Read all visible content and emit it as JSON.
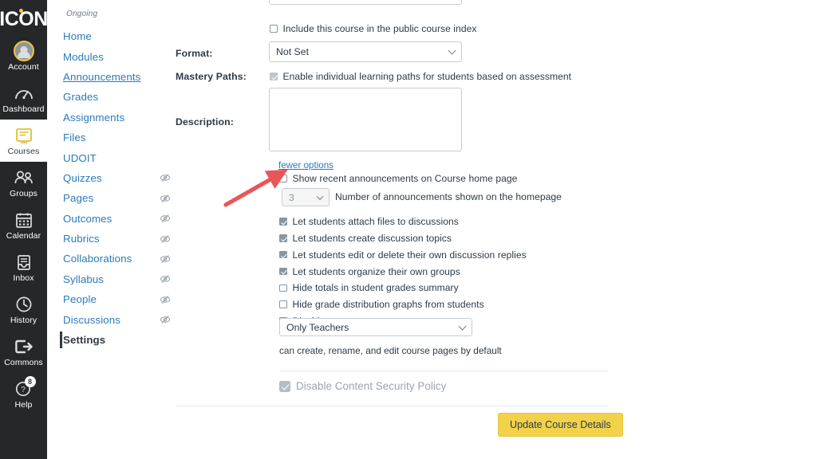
{
  "global_nav": {
    "logo": "ICON",
    "items": [
      {
        "label": "Account",
        "icon": "avatar-icon",
        "badge": null
      },
      {
        "label": "Dashboard",
        "icon": "dashboard-gauge-icon",
        "badge": null
      },
      {
        "label": "Courses",
        "icon": "courses-book-icon",
        "badge": null
      },
      {
        "label": "Groups",
        "icon": "groups-people-icon",
        "badge": null
      },
      {
        "label": "Calendar",
        "icon": "calendar-icon",
        "badge": null
      },
      {
        "label": "Inbox",
        "icon": "inbox-tray-icon",
        "badge": null
      },
      {
        "label": "History",
        "icon": "history-clock-icon",
        "badge": null
      },
      {
        "label": "Commons",
        "icon": "commons-arrow-icon",
        "badge": null
      },
      {
        "label": "Help",
        "icon": "help-question-icon",
        "badge": "8"
      }
    ],
    "active": "Courses"
  },
  "course_nav": {
    "term": "Ongoing",
    "items": [
      {
        "label": "Home",
        "hidden": false
      },
      {
        "label": "Modules",
        "hidden": false
      },
      {
        "label": "Announcements",
        "hidden": false
      },
      {
        "label": "Grades",
        "hidden": false
      },
      {
        "label": "Assignments",
        "hidden": false
      },
      {
        "label": "Files",
        "hidden": false
      },
      {
        "label": "UDOIT",
        "hidden": false
      },
      {
        "label": "Quizzes",
        "hidden": true
      },
      {
        "label": "Pages",
        "hidden": true
      },
      {
        "label": "Outcomes",
        "hidden": true
      },
      {
        "label": "Rubrics",
        "hidden": true
      },
      {
        "label": "Collaborations",
        "hidden": true
      },
      {
        "label": "Syllabus",
        "hidden": true
      },
      {
        "label": "People",
        "hidden": true
      },
      {
        "label": "Discussions",
        "hidden": true
      },
      {
        "label": "Settings",
        "hidden": false
      }
    ],
    "active": "Settings",
    "hidden_icon": "eye-slash-icon"
  },
  "form": {
    "public_index_checkbox": {
      "label": "Include this course in the public course index",
      "checked": false
    },
    "format": {
      "label": "Format:",
      "value": "Not Set"
    },
    "mastery_paths": {
      "label": "Mastery Paths:",
      "checkbox_label": "Enable individual learning paths for students based on assessment",
      "checked": true,
      "disabled": true
    },
    "description": {
      "label": "Description:",
      "value": ""
    },
    "fewer_options_link": "fewer options",
    "show_recent_announcements": {
      "label": "Show recent announcements on Course home page",
      "checked": false
    },
    "announcements_count": {
      "value": "3",
      "label": "Number of announcements shown on the homepage",
      "disabled": true
    },
    "option_checkboxes": [
      {
        "label": "Let students attach files to discussions",
        "checked": true
      },
      {
        "label": "Let students create discussion topics",
        "checked": true
      },
      {
        "label": "Let students edit or delete their own discussion replies",
        "checked": true
      },
      {
        "label": "Let students organize their own groups",
        "checked": true
      },
      {
        "label": "Hide totals in student grades summary",
        "checked": false
      },
      {
        "label": "Hide grade distribution graphs from students",
        "checked": false
      },
      {
        "label": "Disable comments on announcements",
        "checked": false
      }
    ],
    "wiki_permissions": {
      "value": "Only Teachers",
      "helper": "can create, rename, and edit course pages by default"
    },
    "csp": {
      "label": "Disable Content Security Policy",
      "checked": true,
      "disabled": true
    },
    "submit_button": "Update Course Details"
  },
  "annotation": {
    "arrow_color": "#E8565C",
    "points_to": "show-recent-announcements-checkbox"
  }
}
